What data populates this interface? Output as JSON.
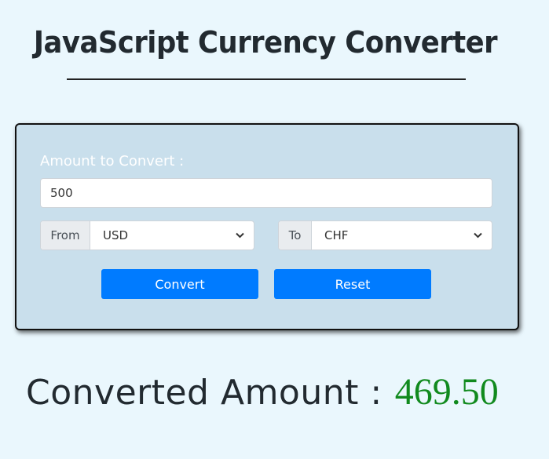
{
  "header": {
    "title": "JavaScript Currency Converter"
  },
  "form": {
    "amount_label": "Amount to Convert :",
    "amount_value": "500",
    "from": {
      "label": "From",
      "selected": "USD"
    },
    "to": {
      "label": "To",
      "selected": "CHF"
    },
    "convert_label": "Convert",
    "reset_label": "Reset"
  },
  "result": {
    "label": "Converted Amount :",
    "value": "469.50"
  },
  "colors": {
    "page_background": "#eaf7fd",
    "card_background": "#c9dfec",
    "button": "#007bff",
    "result_value": "#118a1e"
  }
}
